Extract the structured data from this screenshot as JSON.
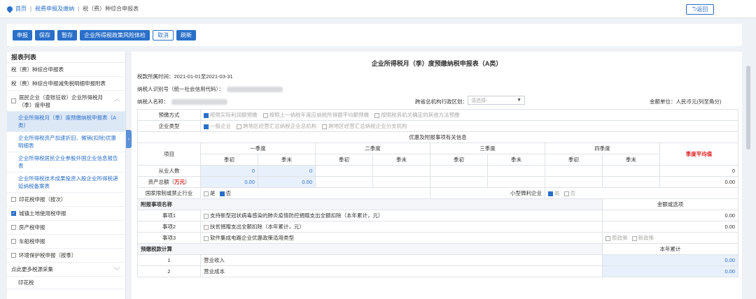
{
  "breadcrumb": {
    "home": "首页",
    "level2": "税费申报及缴纳",
    "level3": "税（费）种综合申报表"
  },
  "back_label": "返回",
  "toolbar": {
    "b1": "申报",
    "b2": "保存",
    "b3": "暂存",
    "b4": "企业所得税政策风险体检",
    "b5": "取消",
    "b6": "刷新"
  },
  "sidebar": {
    "title": "报表列表",
    "items": [
      "税（费）种综合申报表",
      "税（费）种综合申报减免税明细申报附表",
      "居民企业（查账征收）企业所得税月（季）度申报",
      "企业所得税月（季）度预缴纳税申报表（A类）",
      "企业所得税资产加速折旧、摊销(扣除)优惠明细表",
      "企业所得税居民企业参股外国企业信息报告表",
      "企业所得税技术成果投资入股企业所得税递延纳税备案表",
      "印花税申报（按次）",
      "城镇土地使用税申报",
      "房产税申报",
      "车船税申报",
      "环境保护税申报（按季）",
      "点此更多税源采集",
      "印花税"
    ]
  },
  "form": {
    "title": "企业所得税月（季）度预缴纳税申报表（A类）",
    "period": "税款所属时间：2021-01-01至2021-03-31",
    "taxid_label": "纳税人识别号（统一社会信用代码）：",
    "name_label": "纳税人名称：",
    "region_label": "跨省总机构行政区划：",
    "region_placeholder": "请选择-",
    "unit": "金额单位：人民币元(列至角分)",
    "prepay_label": "预缴方式",
    "prepay_opt1": "按照实际利润额预缴",
    "prepay_opt2": "按照上一纳税年度应纳税所得额平均额预缴",
    "prepay_opt3": "按照税务机关确定的其他方法预缴",
    "type_label": "企业类型",
    "type_opt1": "一般企业",
    "type_opt2": "跨地区经营汇总纳税企业总机构",
    "type_opt3": "跨地区经营汇总纳税企业分支机构",
    "pref_section": "优惠及附报事项有关信息",
    "item_col": "项目",
    "q1": "一季度",
    "q2": "二季度",
    "q3": "三季度",
    "q4": "四季度",
    "q_start": "季初",
    "q_end": "季末",
    "avg": "季度平均值",
    "employees": "从业人数",
    "emp_q1_start": "0",
    "emp_q1_end": "0",
    "emp_avg": "0",
    "assets": "资产总额（",
    "assets_unit": "万元",
    "assets_close": "）",
    "assets_q1_start": "0.00",
    "assets_q1_end": "0.00",
    "assets_avg": "0.00",
    "restricted": "国家限制或禁止行业",
    "yes": "是",
    "no": "否",
    "small": "小型微利企业",
    "attach_name": "附报事项名称",
    "amount_opt": "金额或选项",
    "item1_label": "事项1",
    "item1": "支持新型冠状病毒感染的肺炎疫情防控捐赠支出全额扣除（本年累计，元）",
    "item1_val": "0.00",
    "item2_label": "事项2",
    "item2": "扶贫捐赠支出全额扣除（本年累计，元）",
    "item2_val": "0.00",
    "item3_label": "事项3",
    "item3": "软件集成电路企业优惠政策适用类型",
    "orig_policy": "原政策",
    "new_policy": "新政策",
    "calc_section": "预缴税款计算",
    "ytd": "本年累计",
    "row1_no": "1",
    "row1": "营业收入",
    "row1_val": "0.00",
    "row2_no": "2",
    "row2": "营业成本",
    "row2_val": "0.00"
  }
}
